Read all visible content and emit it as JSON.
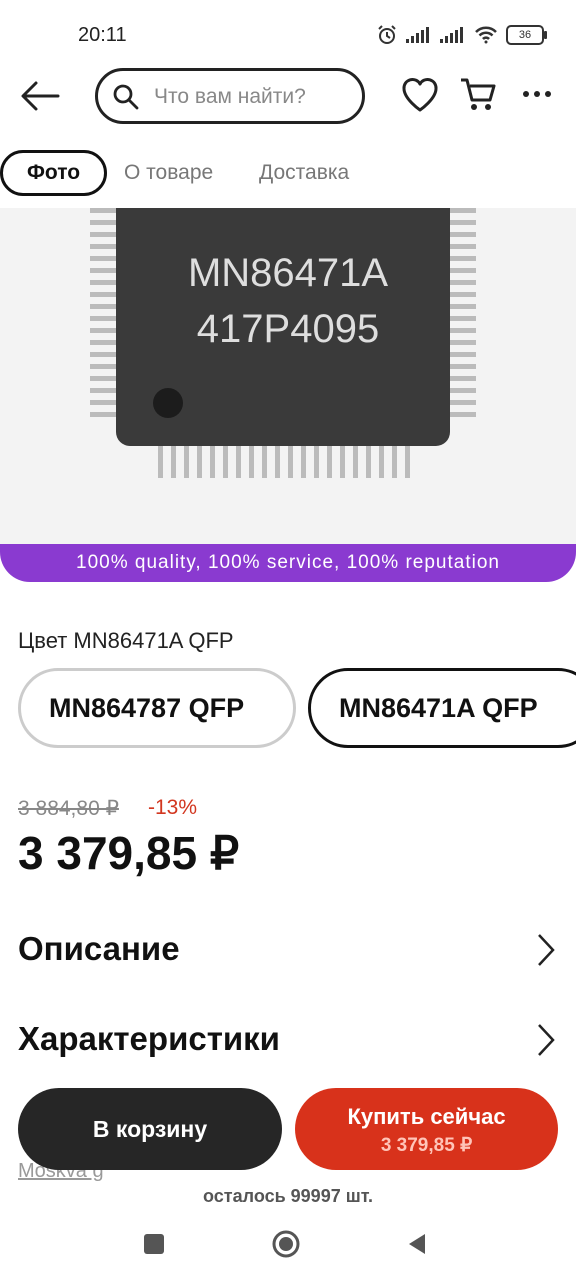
{
  "status_bar": {
    "time": "20:11",
    "battery": "36"
  },
  "header": {
    "search_placeholder": "Что вам найти?"
  },
  "tabs": [
    {
      "label": "Фото",
      "active": true
    },
    {
      "label": "О товаре",
      "active": false
    },
    {
      "label": "Доставка",
      "active": false
    }
  ],
  "product_image": {
    "chip_line1": "MN86471A",
    "chip_line2": "417P4095",
    "banner": "100% quality, 100% service, 100% reputation"
  },
  "color": {
    "label": "Цвет MN86471A QFP",
    "options": [
      "MN864787 QFP",
      "MN86471A QFP"
    ],
    "selected": "MN86471A QFP"
  },
  "price": {
    "old": "3 884,80 ₽",
    "discount": "-13%",
    "current": "3 379,85 ₽"
  },
  "sections": [
    "Описание",
    "Характеристики"
  ],
  "location": "Moskva g",
  "actions": {
    "add_to_cart": "В корзину",
    "buy_now": "Купить сейчас",
    "buy_now_price": "3 379,85 ₽"
  },
  "stock": "осталось 99997 шт.",
  "colors": {
    "accent": "#d8321b",
    "banner": "#8a3ad0",
    "dark_button": "#262626"
  }
}
